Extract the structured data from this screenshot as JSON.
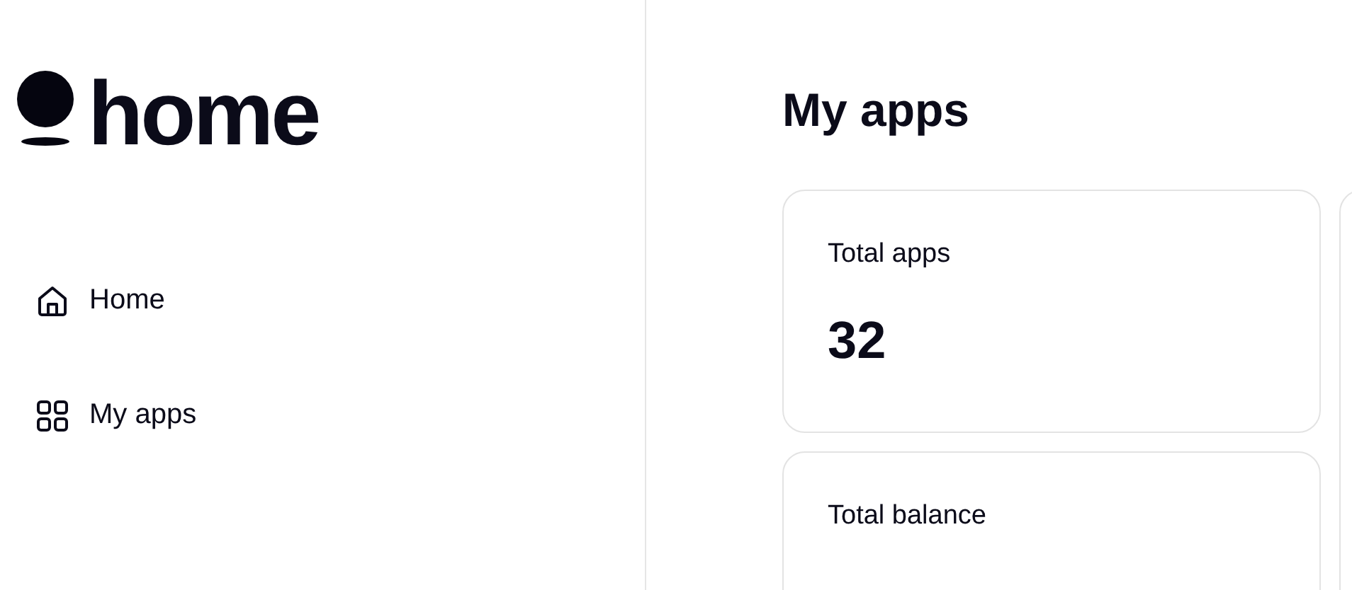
{
  "logo": {
    "text": "home"
  },
  "sidebar": {
    "items": [
      {
        "label": "Home",
        "kind": "home"
      },
      {
        "label": "My apps",
        "kind": "apps"
      }
    ]
  },
  "main": {
    "title": "My apps",
    "cards": [
      {
        "label": "Total apps",
        "value": "32"
      },
      {
        "label": "Total balance"
      }
    ]
  }
}
